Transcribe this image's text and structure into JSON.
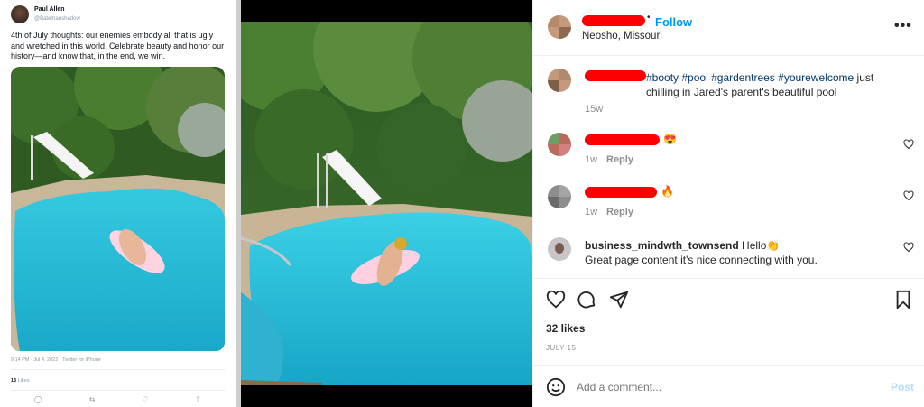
{
  "tweet": {
    "display_name": "Paul Allen",
    "handle": "@Batemanshadow",
    "text": "4th of July thoughts: our enemies embody all that is ugly and wretched in this world. Celebrate beauty and honor our history—and know that, in the end, we win.",
    "meta": "9:14 PM · Jul 4, 2022 · Twitter for iPhone",
    "likes_count": "13",
    "likes_label": "Likes",
    "actions": [
      "reply-icon",
      "retweet-icon",
      "like-icon",
      "share-icon"
    ]
  },
  "post": {
    "follow_label": "Follow",
    "location": "Neosho, Missouri",
    "caption": {
      "hashtags": [
        "#booty",
        "#pool",
        "#gardentrees",
        "#yourewelcome"
      ],
      "text_after": " just chilling in Jared's parent's beautiful pool",
      "age": "15w"
    },
    "comments": [
      {
        "emoji": "😍",
        "age": "1w",
        "reply_label": "Reply"
      },
      {
        "emoji": "🔥",
        "age": "1w",
        "reply_label": "Reply"
      },
      {
        "username": "business_mindwth_townsend",
        "text_inline": "Hello👏",
        "text_line2": "Great page content it's nice connecting with you."
      }
    ],
    "likes": "32 likes",
    "date": "JULY 15",
    "add_comment_placeholder": "Add a comment...",
    "post_label": "Post",
    "more_icon": "more-options-icon"
  },
  "colors": {
    "accent": "#0095f6",
    "redaction": "#ff0000",
    "hashtag": "#00376b"
  }
}
